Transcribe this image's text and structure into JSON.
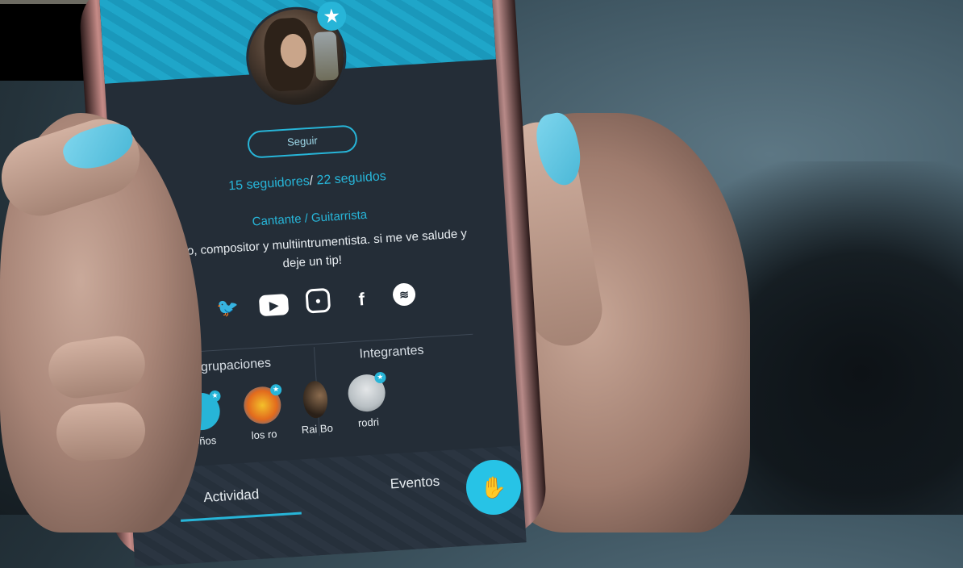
{
  "profile": {
    "follow_label": "Seguir",
    "followers": "15 seguidores",
    "separator": "/",
    "following": "22 seguidos",
    "role": "Cantante / Guitarrista",
    "bio": "Músico, compositor y multiintrumentista. si me ve salude y deje un tip!"
  },
  "socials": [
    {
      "icon": "twitter-icon"
    },
    {
      "icon": "youtube-icon"
    },
    {
      "icon": "instagram-icon"
    },
    {
      "icon": "facebook-icon"
    },
    {
      "icon": "spotify-icon"
    }
  ],
  "sections": {
    "groups_title": "Agrupaciones",
    "members_title": "Integrantes"
  },
  "groups": [
    {
      "name": "roños"
    },
    {
      "name": "los ro"
    },
    {
      "name": "Rai Bo"
    }
  ],
  "members": [
    {
      "name": "rodri"
    }
  ],
  "tabs": {
    "activity": "Actividad",
    "events": "Eventos"
  },
  "colors": {
    "accent": "#27b5d8",
    "screen_bg": "#242d37",
    "nail": "#5cc7e4"
  }
}
